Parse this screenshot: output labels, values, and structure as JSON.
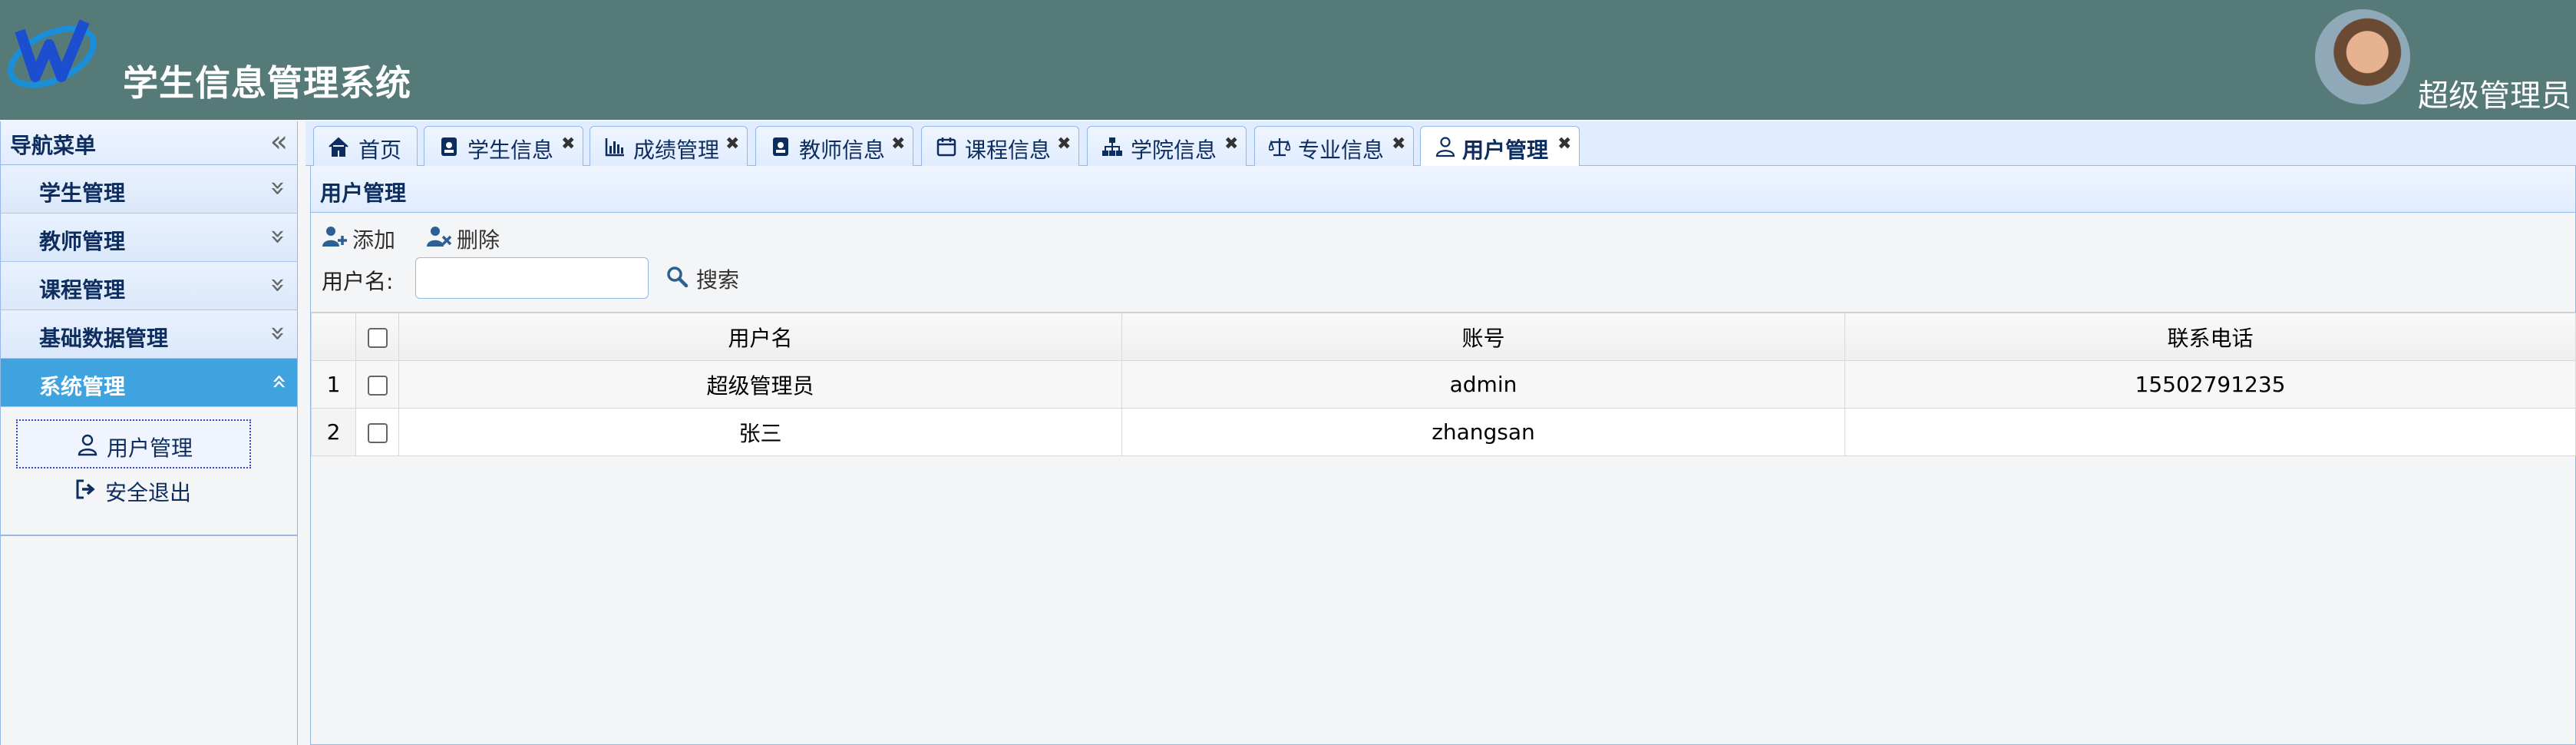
{
  "header": {
    "app_title": "学生信息管理系统",
    "user_name": "超级管理员",
    "bg_color": "#567a78"
  },
  "sidebar": {
    "title": "导航菜单",
    "sections": [
      {
        "label": "学生管理",
        "expanded": false
      },
      {
        "label": "教师管理",
        "expanded": false
      },
      {
        "label": "课程管理",
        "expanded": false
      },
      {
        "label": "基础数据管理",
        "expanded": false
      },
      {
        "label": "系统管理",
        "expanded": true
      }
    ],
    "sub_items": [
      {
        "label": "用户管理",
        "icon": "user-icon",
        "selected": true
      },
      {
        "label": "安全退出",
        "icon": "sign-out-icon",
        "selected": false
      }
    ],
    "active_color": "#3fa3e0"
  },
  "tabs": [
    {
      "label": "首页",
      "icon": "home-icon",
      "closable": false
    },
    {
      "label": "学生信息",
      "icon": "id-badge-icon",
      "closable": true
    },
    {
      "label": "成绩管理",
      "icon": "bar-chart-icon",
      "closable": true
    },
    {
      "label": "教师信息",
      "icon": "id-badge-icon",
      "closable": true
    },
    {
      "label": "课程信息",
      "icon": "calendar-icon",
      "closable": true
    },
    {
      "label": "学院信息",
      "icon": "sitemap-icon",
      "closable": true
    },
    {
      "label": "专业信息",
      "icon": "balance-scale-icon",
      "closable": true
    },
    {
      "label": "用户管理",
      "icon": "user-icon",
      "closable": true,
      "active": true
    }
  ],
  "tab_close_glyph": "✖",
  "panel": {
    "title": "用户管理",
    "add_label": "添加",
    "delete_label": "删除",
    "search_label": "用户名:",
    "search_value": "",
    "search_button_label": "搜索"
  },
  "grid": {
    "columns": [
      "用户名",
      "账号",
      "联系电话"
    ],
    "rows": [
      {
        "row_number": "1",
        "username": "超级管理员",
        "account": "admin",
        "phone": "15502791235"
      },
      {
        "row_number": "2",
        "username": "张三",
        "account": "zhangsan",
        "phone": ""
      }
    ]
  }
}
